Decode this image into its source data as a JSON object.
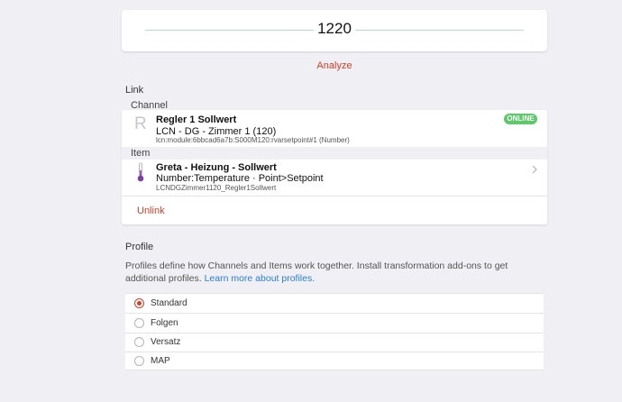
{
  "value_display": {
    "value": "1220"
  },
  "analyze_label": "Analyze",
  "link": {
    "section_label": "Link",
    "channel_header": "Channel",
    "channel": {
      "icon_letter": "R",
      "title": "Regler 1 Sollwert",
      "subtitle": "LCN - DG - Zimmer 1 (120)",
      "uid": "lcn:module:6bbcad6a7b:S000M120:rvarsetpoint#1 (Number)",
      "status": "ONLINE",
      "status_color": "#5cc96a"
    },
    "item_header": "Item",
    "item": {
      "icon": "thermometer-icon",
      "title": "Greta - Heizung - Sollwert",
      "subtitle": "Number:Temperature · Point>Setpoint",
      "name": "LCNDGZimmer1120_Regler1Sollwert"
    },
    "unlink_label": "Unlink"
  },
  "profile": {
    "section_label": "Profile",
    "description": "Profiles define how Channels and Items work together. Install transformation add-ons to get additional profiles.",
    "learn_more_label": "Learn more about profiles.",
    "options": [
      {
        "label": "Standard",
        "selected": true
      },
      {
        "label": "Folgen",
        "selected": false
      },
      {
        "label": "Versatz",
        "selected": false
      },
      {
        "label": "MAP",
        "selected": false
      }
    ]
  },
  "colors": {
    "accent": "#d23f25",
    "link": "#2a7fd4",
    "online": "#5cc96a"
  }
}
